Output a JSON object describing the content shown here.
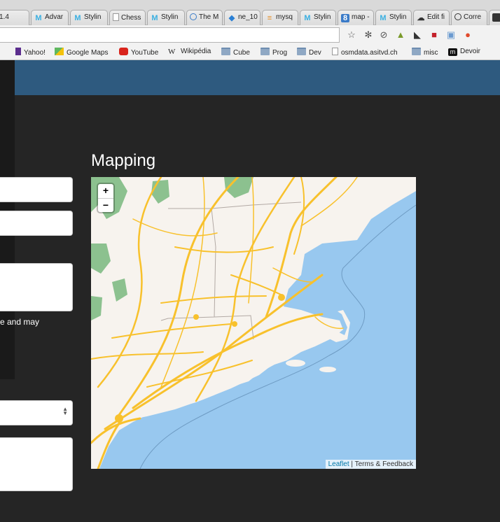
{
  "browser": {
    "tabs": [
      {
        "label": "1.4",
        "icon": ""
      },
      {
        "label": "Advar",
        "icon": "M"
      },
      {
        "label": "Stylin",
        "icon": "M"
      },
      {
        "label": "Chess",
        "icon": ""
      },
      {
        "label": "Stylin",
        "icon": "M"
      },
      {
        "label": "The M",
        "icon": ""
      },
      {
        "label": "ne_10",
        "icon": ""
      },
      {
        "label": "mysq",
        "icon": ""
      },
      {
        "label": "Stylin",
        "icon": "M"
      },
      {
        "label": "map -",
        "icon": "8"
      },
      {
        "label": "Stylin",
        "icon": "M"
      },
      {
        "label": "Edit fi",
        "icon": ""
      },
      {
        "label": "Corre",
        "icon": ""
      }
    ],
    "bookmarks": [
      {
        "label": "Yahoo!",
        "kind": "yahoo"
      },
      {
        "label": "Google Maps",
        "kind": "maps"
      },
      {
        "label": "YouTube",
        "kind": "youtube"
      },
      {
        "label": "Wikipédia",
        "kind": "wiki"
      },
      {
        "label": "Cube",
        "kind": "folder"
      },
      {
        "label": "Prog",
        "kind": "folder"
      },
      {
        "label": "Dev",
        "kind": "folder"
      },
      {
        "label": "osmdata.asitvd.ch",
        "kind": "page"
      },
      {
        "label": "misc",
        "kind": "folder"
      },
      {
        "label": "Devoir",
        "kind": "m"
      }
    ],
    "toolbar_icons": [
      "star-icon",
      "gear-icon",
      "sync-icon",
      "extension-icon",
      "extension-icon",
      "extension-icon",
      "extension-icon",
      "extension-icon"
    ]
  },
  "form": {
    "help_text": "e and may",
    "select_arrows": "▴▾"
  },
  "section": {
    "title": "Mapping"
  },
  "map": {
    "zoom_in": "+",
    "zoom_out": "−",
    "attribution_link": "Leaflet",
    "attribution_sep": " | ",
    "attribution_text": "Terms & Feedback"
  },
  "colors": {
    "header": "#2e5a7f",
    "page_bg": "#252525",
    "water": "#98c8ef",
    "land": "#f7f3ee",
    "roads": "#f8c12c"
  }
}
